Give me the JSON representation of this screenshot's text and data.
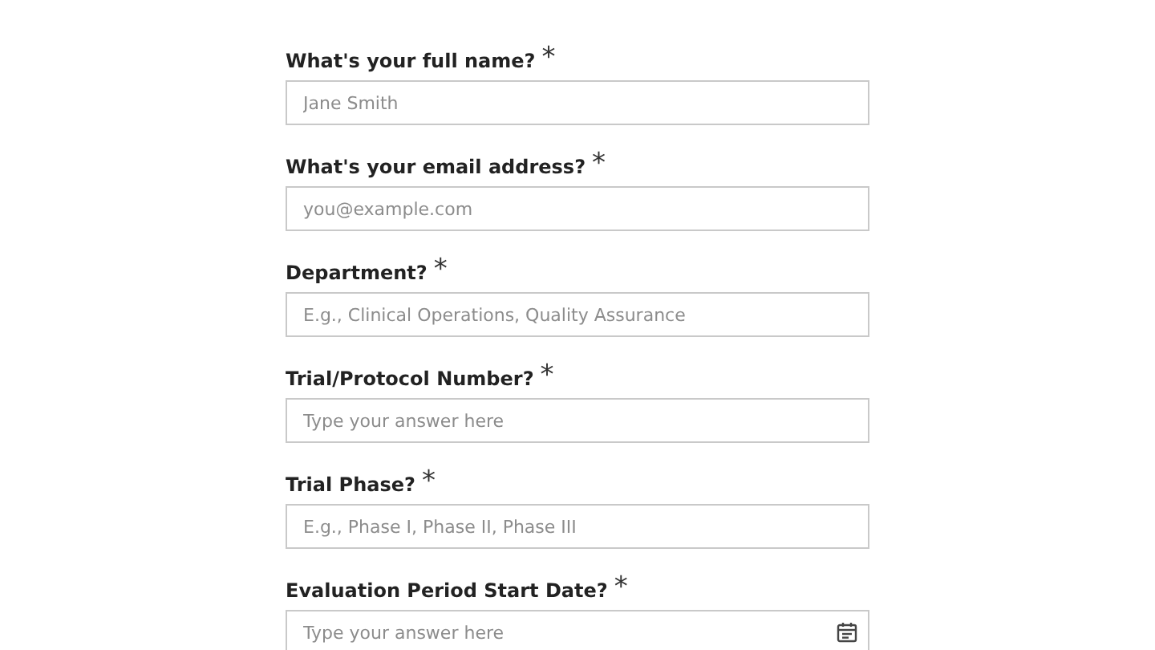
{
  "fields": [
    {
      "label": "What's your full name?",
      "required_mark": "*",
      "placeholder": "Jane Smith",
      "kind": "text"
    },
    {
      "label": "What's your email address?",
      "required_mark": "*",
      "placeholder": "you@example.com",
      "kind": "text"
    },
    {
      "label": "Department?",
      "required_mark": "*",
      "placeholder": "E.g., Clinical Operations, Quality Assurance",
      "kind": "text"
    },
    {
      "label": "Trial/Protocol Number?",
      "required_mark": "*",
      "placeholder": "Type your answer here",
      "kind": "text"
    },
    {
      "label": "Trial Phase?",
      "required_mark": "*",
      "placeholder": "E.g., Phase I, Phase II, Phase III",
      "kind": "text"
    },
    {
      "label": "Evaluation Period Start Date?",
      "required_mark": "*",
      "placeholder": "Type your answer here",
      "kind": "date"
    }
  ]
}
